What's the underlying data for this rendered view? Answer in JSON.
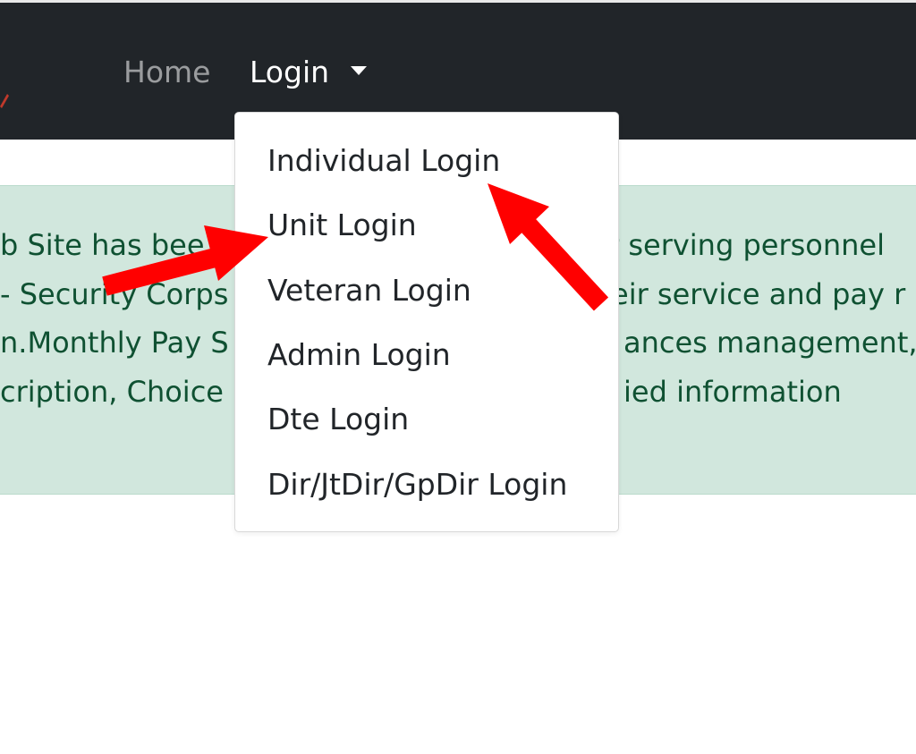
{
  "navbar": {
    "home_label": "Home",
    "login_label": "Login",
    "background": "#212529"
  },
  "alert": {
    "lines": [
      "b Site has bee",
      "r serving personnel",
      "- Security Corps",
      "eir service and pay r",
      "n.Monthly Pay S",
      "ances management,",
      "cription, Choice",
      "ied information"
    ],
    "background": "#d1e7dd",
    "text_color": "#0f5132"
  },
  "dropdown": {
    "items": [
      "Individual Login",
      "Unit Login",
      "Veteran Login",
      "Admin Login",
      "Dte Login",
      "Dir/JtDir/GpDir Login"
    ]
  },
  "annotations": {
    "arrow_color": "#ff0000",
    "arrow_icon": "red-arrow-icon"
  }
}
